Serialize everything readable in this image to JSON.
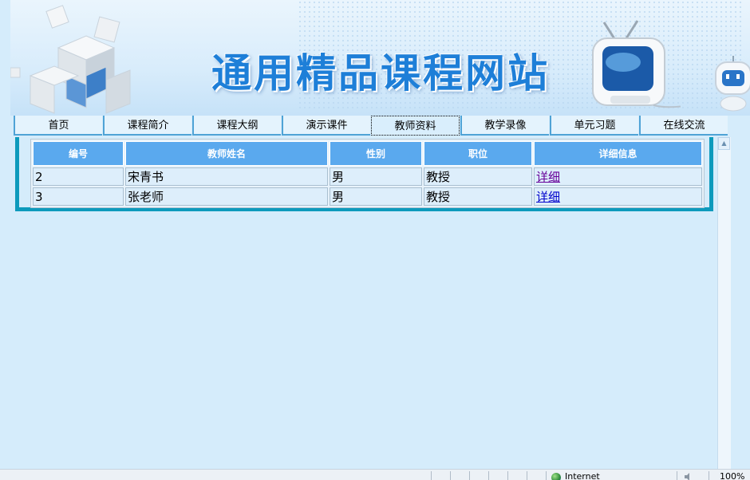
{
  "banner": {
    "title": "通用精品课程网站"
  },
  "nav": {
    "items": [
      {
        "label": "首页",
        "active": false
      },
      {
        "label": "课程简介",
        "active": false
      },
      {
        "label": "课程大纲",
        "active": false
      },
      {
        "label": "演示课件",
        "active": false
      },
      {
        "label": "教师资料",
        "active": true
      },
      {
        "label": "教学录像",
        "active": false
      },
      {
        "label": "单元习题",
        "active": false
      },
      {
        "label": "在线交流",
        "active": false
      }
    ]
  },
  "table": {
    "headers": [
      "编号",
      "教师姓名",
      "性别",
      "职位",
      "详细信息"
    ],
    "rows": [
      {
        "id": "2",
        "name": "宋青书",
        "gender": "男",
        "title": "教授",
        "detail": "详细"
      },
      {
        "id": "3",
        "name": "张老师",
        "gender": "男",
        "title": "教授",
        "detail": "详细"
      }
    ]
  },
  "statusbar": {
    "zone": "Internet",
    "zoom": "100%"
  },
  "colors": {
    "page_bg": "#d5ecfb",
    "header_cell": "#5aa9ee",
    "frame": "#0d9abc",
    "title_blue": "#1e7fd8"
  }
}
